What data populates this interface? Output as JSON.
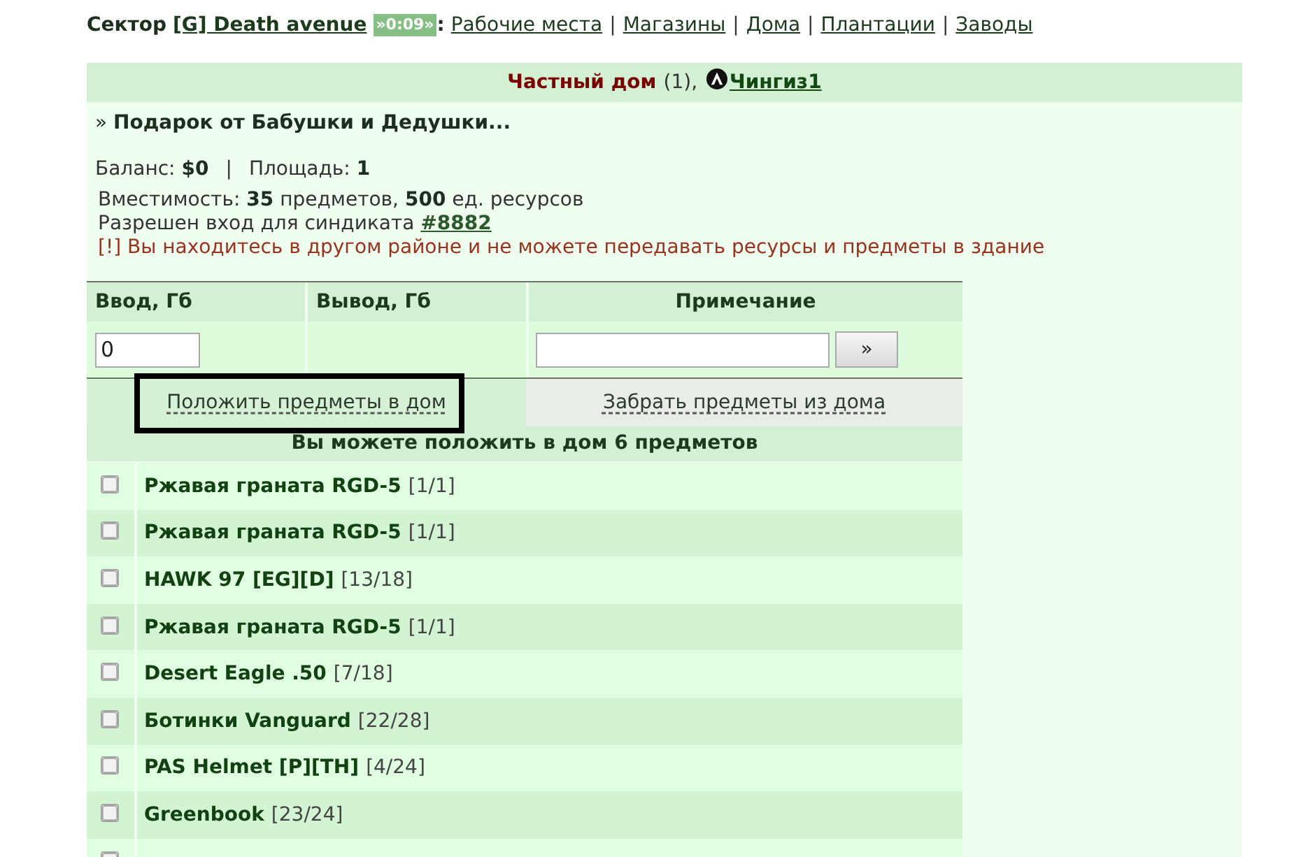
{
  "top_nav": {
    "label": "Сектор",
    "sector_link": "[G] Death avenue",
    "timer": "»0:09»",
    "suffix": ":",
    "items": [
      {
        "kind": "link",
        "text": "Рабочие места"
      },
      {
        "kind": "separator",
        "text": "|"
      },
      {
        "kind": "link",
        "text": "Магазины"
      },
      {
        "kind": "separator",
        "text": "|"
      },
      {
        "kind": "link",
        "text": "Дома"
      },
      {
        "kind": "separator",
        "text": "|"
      },
      {
        "kind": "link",
        "text": "Плантации"
      },
      {
        "kind": "separator",
        "text": "|"
      },
      {
        "kind": "link",
        "text": "Заводы"
      }
    ]
  },
  "house": {
    "type": "Частный дом",
    "count": "(1),",
    "owner": "Чингиз1"
  },
  "gift": "» **Подарок от Бабушки и Дедушки...**",
  "balance": {
    "money": "Баланс: **$0**",
    "separator": "|",
    "area": "Площадь: **1**"
  },
  "capacity": "Вместимость: **35** предметов, **500** ед. ресурсов",
  "access": {
    "text": "Разрешен вход для синдиката",
    "link": "#8882"
  },
  "warning": "[!] Вы находитесь в другом районе и не можете передавать ресурсы и предметы в здание",
  "transfer_table": {
    "columns": [
      "Ввод, Гб",
      "Вывод, Гб",
      "Примечание"
    ],
    "input_value": "0",
    "submit": "»"
  },
  "tabs": [
    {
      "label": "Положить предметы в дом",
      "selected": true,
      "highlighted": true
    },
    {
      "label": "Забрать предметы из дома",
      "selected": false,
      "highlighted": false
    }
  ],
  "items_caption": "Вы можете положить в дом 6 предметов",
  "items": [
    {
      "name": "Ржавая граната RGD-5",
      "durability": "[1/1]",
      "checked": false
    },
    {
      "name": "Ржавая граната RGD-5",
      "durability": "[1/1]",
      "checked": false
    },
    {
      "name": "HAWK 97 [EG][D]",
      "durability": "[13/18]",
      "checked": false
    },
    {
      "name": "Ржавая граната RGD-5",
      "durability": "[1/1]",
      "checked": false
    },
    {
      "name": "Desert Eagle .50",
      "durability": "[7/18]",
      "checked": false
    },
    {
      "name": "Ботинки Vanguard",
      "durability": "[22/28]",
      "checked": false
    },
    {
      "name": "PAS Helmet [P][TH]",
      "durability": "[4/24]",
      "checked": false
    },
    {
      "name": "Greenbook",
      "durability": "[23/24]",
      "checked": false
    },
    {
      "checked": false
    }
  ]
}
